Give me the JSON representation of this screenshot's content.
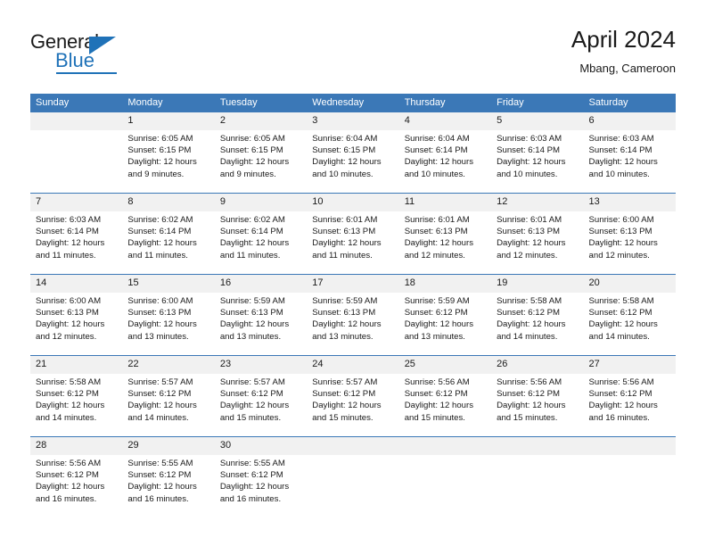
{
  "brand": {
    "name_part1": "General",
    "name_part2": "Blue",
    "triangle_icon": "triangle-icon",
    "accent_color": "#1f72b8"
  },
  "header": {
    "title": "April 2024",
    "subtitle": "Mbang, Cameroon"
  },
  "calendar": {
    "header_color": "#3b78b7",
    "daynum_bg": "#f1f1f1",
    "weekdays": [
      "Sunday",
      "Monday",
      "Tuesday",
      "Wednesday",
      "Thursday",
      "Friday",
      "Saturday"
    ],
    "weeks": [
      [
        {
          "day": "",
          "sunrise": "",
          "sunset": "",
          "daylight": ""
        },
        {
          "day": "1",
          "sunrise": "Sunrise: 6:05 AM",
          "sunset": "Sunset: 6:15 PM",
          "daylight": "Daylight: 12 hours and 9 minutes."
        },
        {
          "day": "2",
          "sunrise": "Sunrise: 6:05 AM",
          "sunset": "Sunset: 6:15 PM",
          "daylight": "Daylight: 12 hours and 9 minutes."
        },
        {
          "day": "3",
          "sunrise": "Sunrise: 6:04 AM",
          "sunset": "Sunset: 6:15 PM",
          "daylight": "Daylight: 12 hours and 10 minutes."
        },
        {
          "day": "4",
          "sunrise": "Sunrise: 6:04 AM",
          "sunset": "Sunset: 6:14 PM",
          "daylight": "Daylight: 12 hours and 10 minutes."
        },
        {
          "day": "5",
          "sunrise": "Sunrise: 6:03 AM",
          "sunset": "Sunset: 6:14 PM",
          "daylight": "Daylight: 12 hours and 10 minutes."
        },
        {
          "day": "6",
          "sunrise": "Sunrise: 6:03 AM",
          "sunset": "Sunset: 6:14 PM",
          "daylight": "Daylight: 12 hours and 10 minutes."
        }
      ],
      [
        {
          "day": "7",
          "sunrise": "Sunrise: 6:03 AM",
          "sunset": "Sunset: 6:14 PM",
          "daylight": "Daylight: 12 hours and 11 minutes."
        },
        {
          "day": "8",
          "sunrise": "Sunrise: 6:02 AM",
          "sunset": "Sunset: 6:14 PM",
          "daylight": "Daylight: 12 hours and 11 minutes."
        },
        {
          "day": "9",
          "sunrise": "Sunrise: 6:02 AM",
          "sunset": "Sunset: 6:14 PM",
          "daylight": "Daylight: 12 hours and 11 minutes."
        },
        {
          "day": "10",
          "sunrise": "Sunrise: 6:01 AM",
          "sunset": "Sunset: 6:13 PM",
          "daylight": "Daylight: 12 hours and 11 minutes."
        },
        {
          "day": "11",
          "sunrise": "Sunrise: 6:01 AM",
          "sunset": "Sunset: 6:13 PM",
          "daylight": "Daylight: 12 hours and 12 minutes."
        },
        {
          "day": "12",
          "sunrise": "Sunrise: 6:01 AM",
          "sunset": "Sunset: 6:13 PM",
          "daylight": "Daylight: 12 hours and 12 minutes."
        },
        {
          "day": "13",
          "sunrise": "Sunrise: 6:00 AM",
          "sunset": "Sunset: 6:13 PM",
          "daylight": "Daylight: 12 hours and 12 minutes."
        }
      ],
      [
        {
          "day": "14",
          "sunrise": "Sunrise: 6:00 AM",
          "sunset": "Sunset: 6:13 PM",
          "daylight": "Daylight: 12 hours and 12 minutes."
        },
        {
          "day": "15",
          "sunrise": "Sunrise: 6:00 AM",
          "sunset": "Sunset: 6:13 PM",
          "daylight": "Daylight: 12 hours and 13 minutes."
        },
        {
          "day": "16",
          "sunrise": "Sunrise: 5:59 AM",
          "sunset": "Sunset: 6:13 PM",
          "daylight": "Daylight: 12 hours and 13 minutes."
        },
        {
          "day": "17",
          "sunrise": "Sunrise: 5:59 AM",
          "sunset": "Sunset: 6:13 PM",
          "daylight": "Daylight: 12 hours and 13 minutes."
        },
        {
          "day": "18",
          "sunrise": "Sunrise: 5:59 AM",
          "sunset": "Sunset: 6:12 PM",
          "daylight": "Daylight: 12 hours and 13 minutes."
        },
        {
          "day": "19",
          "sunrise": "Sunrise: 5:58 AM",
          "sunset": "Sunset: 6:12 PM",
          "daylight": "Daylight: 12 hours and 14 minutes."
        },
        {
          "day": "20",
          "sunrise": "Sunrise: 5:58 AM",
          "sunset": "Sunset: 6:12 PM",
          "daylight": "Daylight: 12 hours and 14 minutes."
        }
      ],
      [
        {
          "day": "21",
          "sunrise": "Sunrise: 5:58 AM",
          "sunset": "Sunset: 6:12 PM",
          "daylight": "Daylight: 12 hours and 14 minutes."
        },
        {
          "day": "22",
          "sunrise": "Sunrise: 5:57 AM",
          "sunset": "Sunset: 6:12 PM",
          "daylight": "Daylight: 12 hours and 14 minutes."
        },
        {
          "day": "23",
          "sunrise": "Sunrise: 5:57 AM",
          "sunset": "Sunset: 6:12 PM",
          "daylight": "Daylight: 12 hours and 15 minutes."
        },
        {
          "day": "24",
          "sunrise": "Sunrise: 5:57 AM",
          "sunset": "Sunset: 6:12 PM",
          "daylight": "Daylight: 12 hours and 15 minutes."
        },
        {
          "day": "25",
          "sunrise": "Sunrise: 5:56 AM",
          "sunset": "Sunset: 6:12 PM",
          "daylight": "Daylight: 12 hours and 15 minutes."
        },
        {
          "day": "26",
          "sunrise": "Sunrise: 5:56 AM",
          "sunset": "Sunset: 6:12 PM",
          "daylight": "Daylight: 12 hours and 15 minutes."
        },
        {
          "day": "27",
          "sunrise": "Sunrise: 5:56 AM",
          "sunset": "Sunset: 6:12 PM",
          "daylight": "Daylight: 12 hours and 16 minutes."
        }
      ],
      [
        {
          "day": "28",
          "sunrise": "Sunrise: 5:56 AM",
          "sunset": "Sunset: 6:12 PM",
          "daylight": "Daylight: 12 hours and 16 minutes."
        },
        {
          "day": "29",
          "sunrise": "Sunrise: 5:55 AM",
          "sunset": "Sunset: 6:12 PM",
          "daylight": "Daylight: 12 hours and 16 minutes."
        },
        {
          "day": "30",
          "sunrise": "Sunrise: 5:55 AM",
          "sunset": "Sunset: 6:12 PM",
          "daylight": "Daylight: 12 hours and 16 minutes."
        },
        {
          "day": "",
          "sunrise": "",
          "sunset": "",
          "daylight": ""
        },
        {
          "day": "",
          "sunrise": "",
          "sunset": "",
          "daylight": ""
        },
        {
          "day": "",
          "sunrise": "",
          "sunset": "",
          "daylight": ""
        },
        {
          "day": "",
          "sunrise": "",
          "sunset": "",
          "daylight": ""
        }
      ]
    ]
  }
}
